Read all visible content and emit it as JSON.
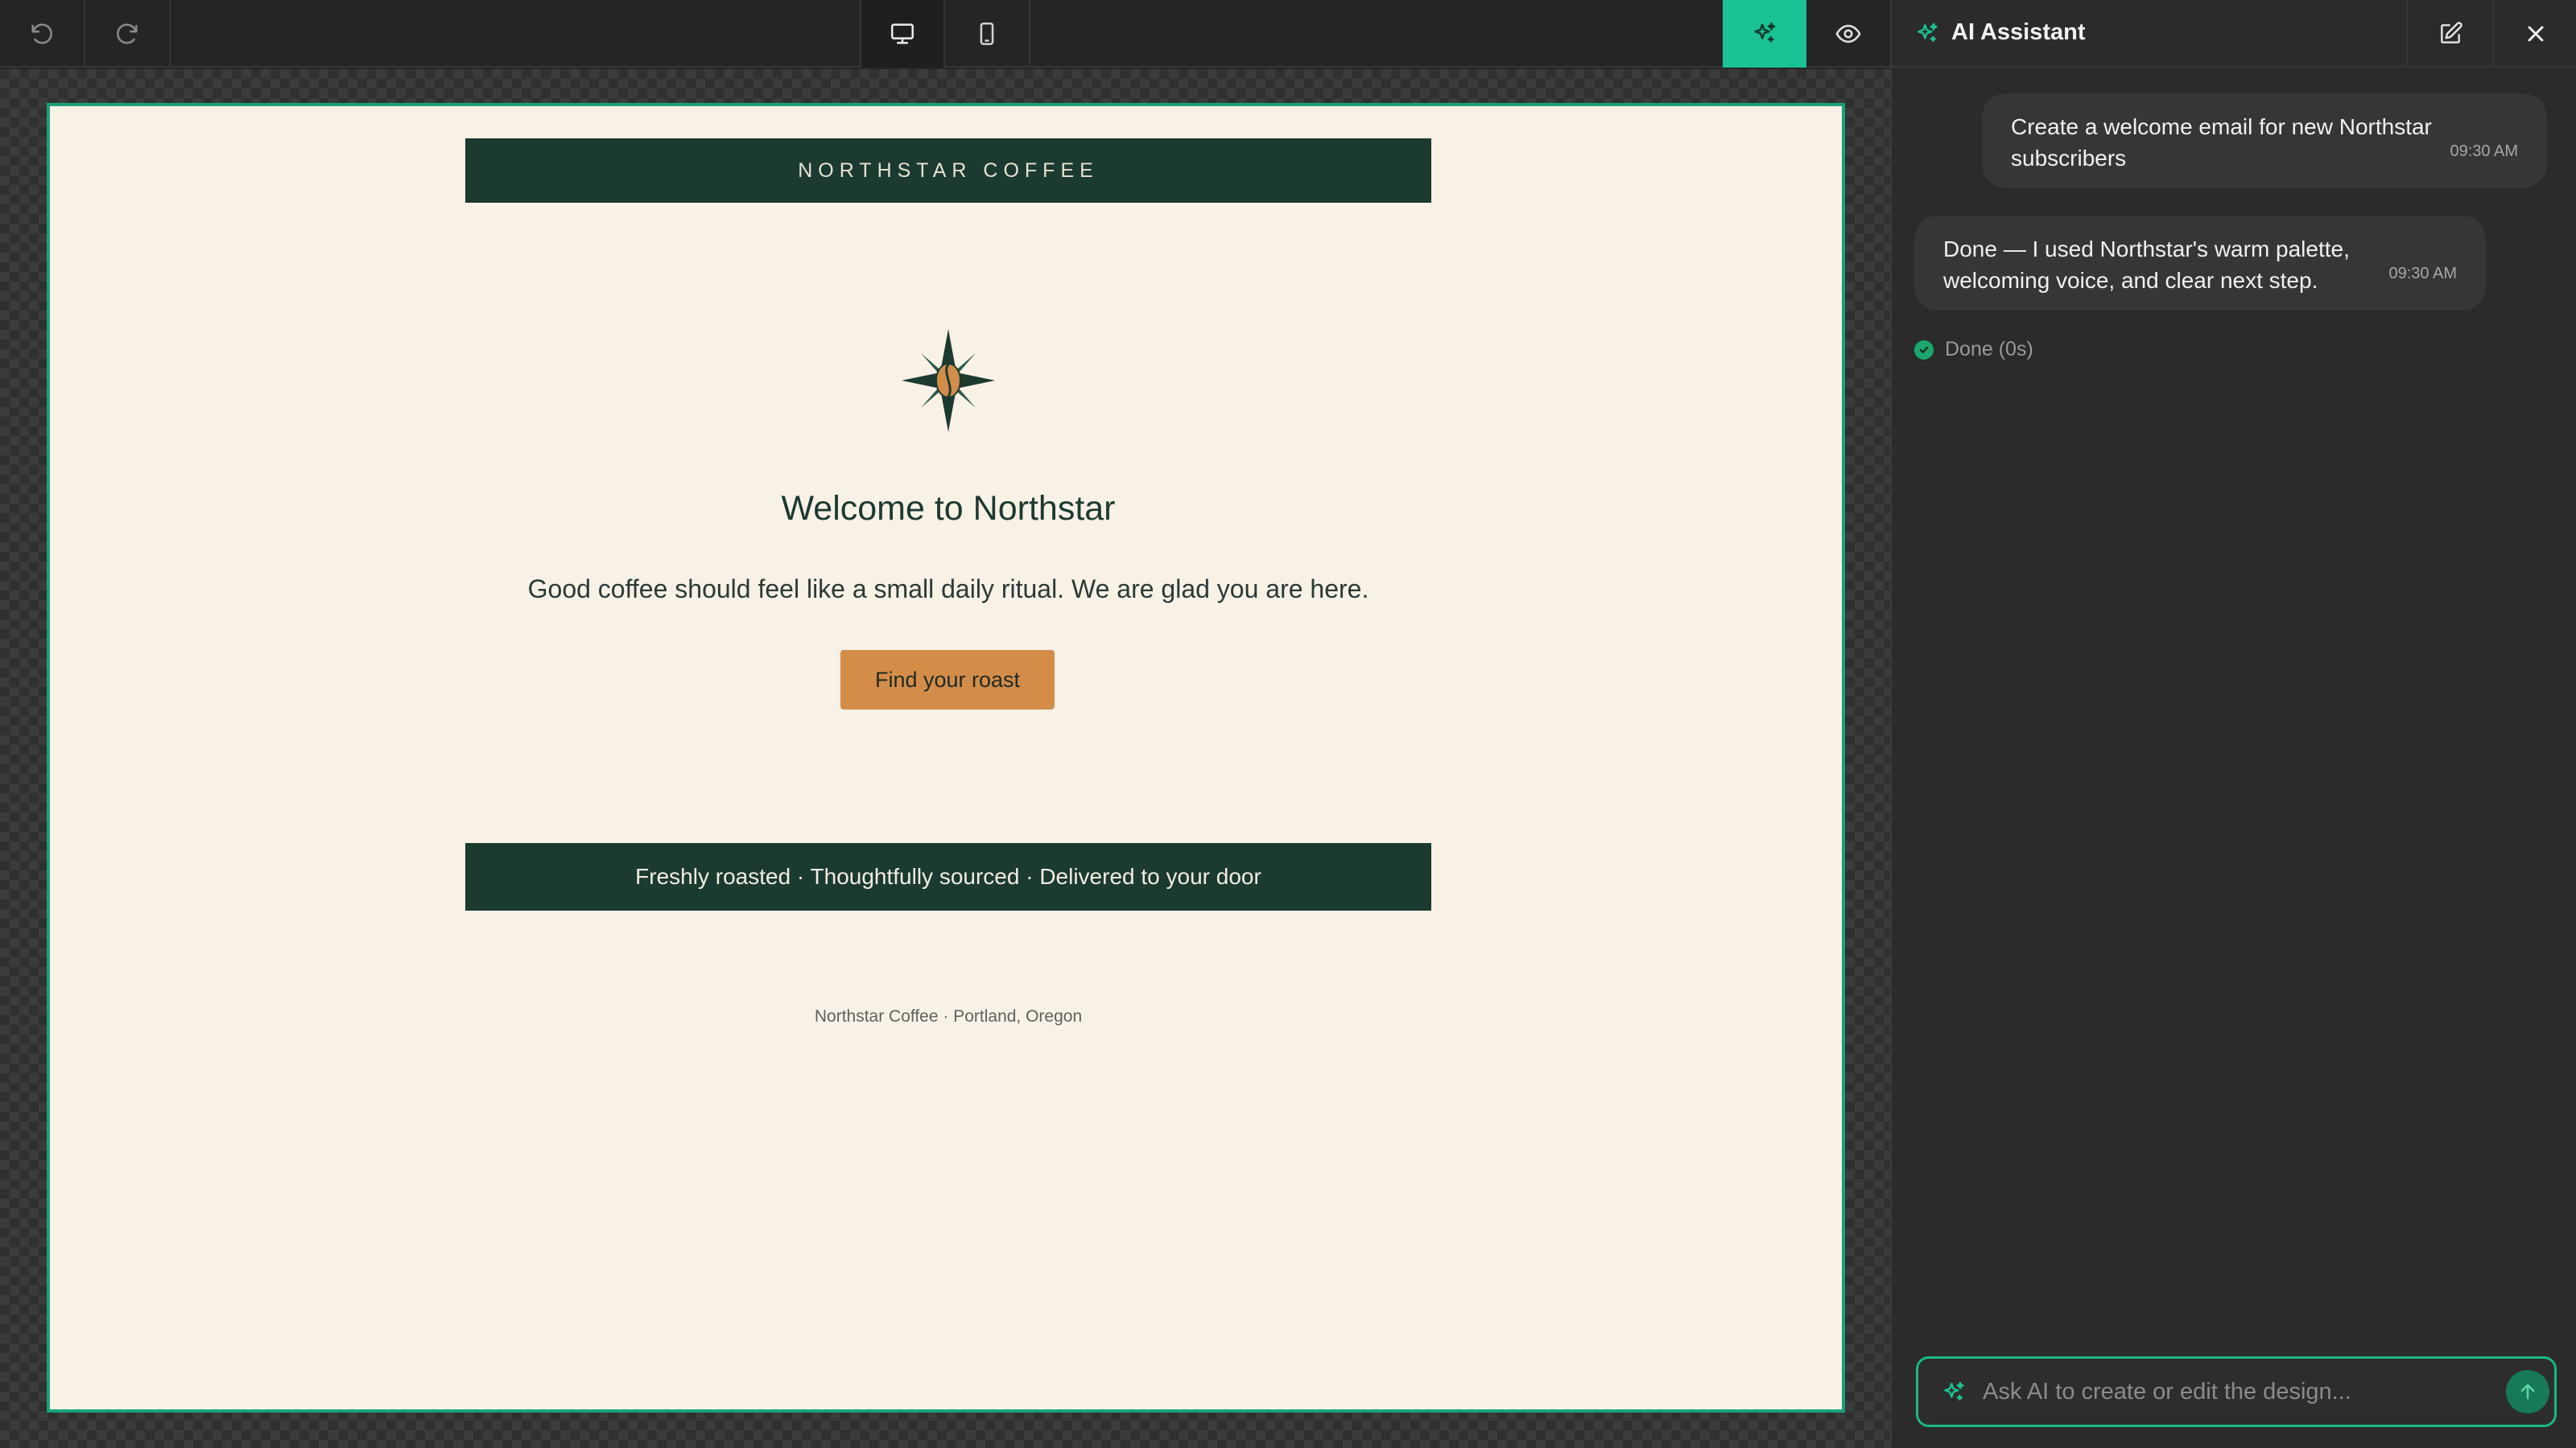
{
  "toolbar": {
    "undo_icon": "undo-icon",
    "redo_icon": "redo-icon",
    "desktop_icon": "desktop-icon",
    "mobile_icon": "mobile-icon",
    "ai_icon": "sparkle-icon",
    "preview_icon": "eye-icon",
    "accent_color": "#19c393"
  },
  "email": {
    "header_brand": "NORTHSTAR COFFEE",
    "logo_icon": "compass-coffee-bean-icon",
    "heading": "Welcome to Northstar",
    "body": "Good coffee should feel like a small daily ritual. We are glad you are here.",
    "cta_label": "Find your roast",
    "strip_text": "Freshly roasted · Thoughtfully sourced · Delivered to your door",
    "footer": "Northstar Coffee · Portland, Oregon",
    "colors": {
      "background": "#f8f1e6",
      "dark_green": "#1b3a30",
      "accent_orange": "#d38d48"
    }
  },
  "assistant": {
    "title": "AI Assistant",
    "title_icon": "sparkle-icon",
    "edit_icon": "edit-icon",
    "close_icon": "close-icon",
    "messages": [
      {
        "role": "user",
        "text": "Create a welcome email for new Northstar subscribers",
        "time": "09:30 AM"
      },
      {
        "role": "assistant",
        "text": "Done — I used Northstar's warm palette, welcoming voice, and clear next step.",
        "time": "09:30 AM"
      }
    ],
    "status": "Done (0s)",
    "input_placeholder": "Ask AI to create or edit the design...",
    "input_value": "",
    "send_icon": "arrow-up-icon"
  }
}
